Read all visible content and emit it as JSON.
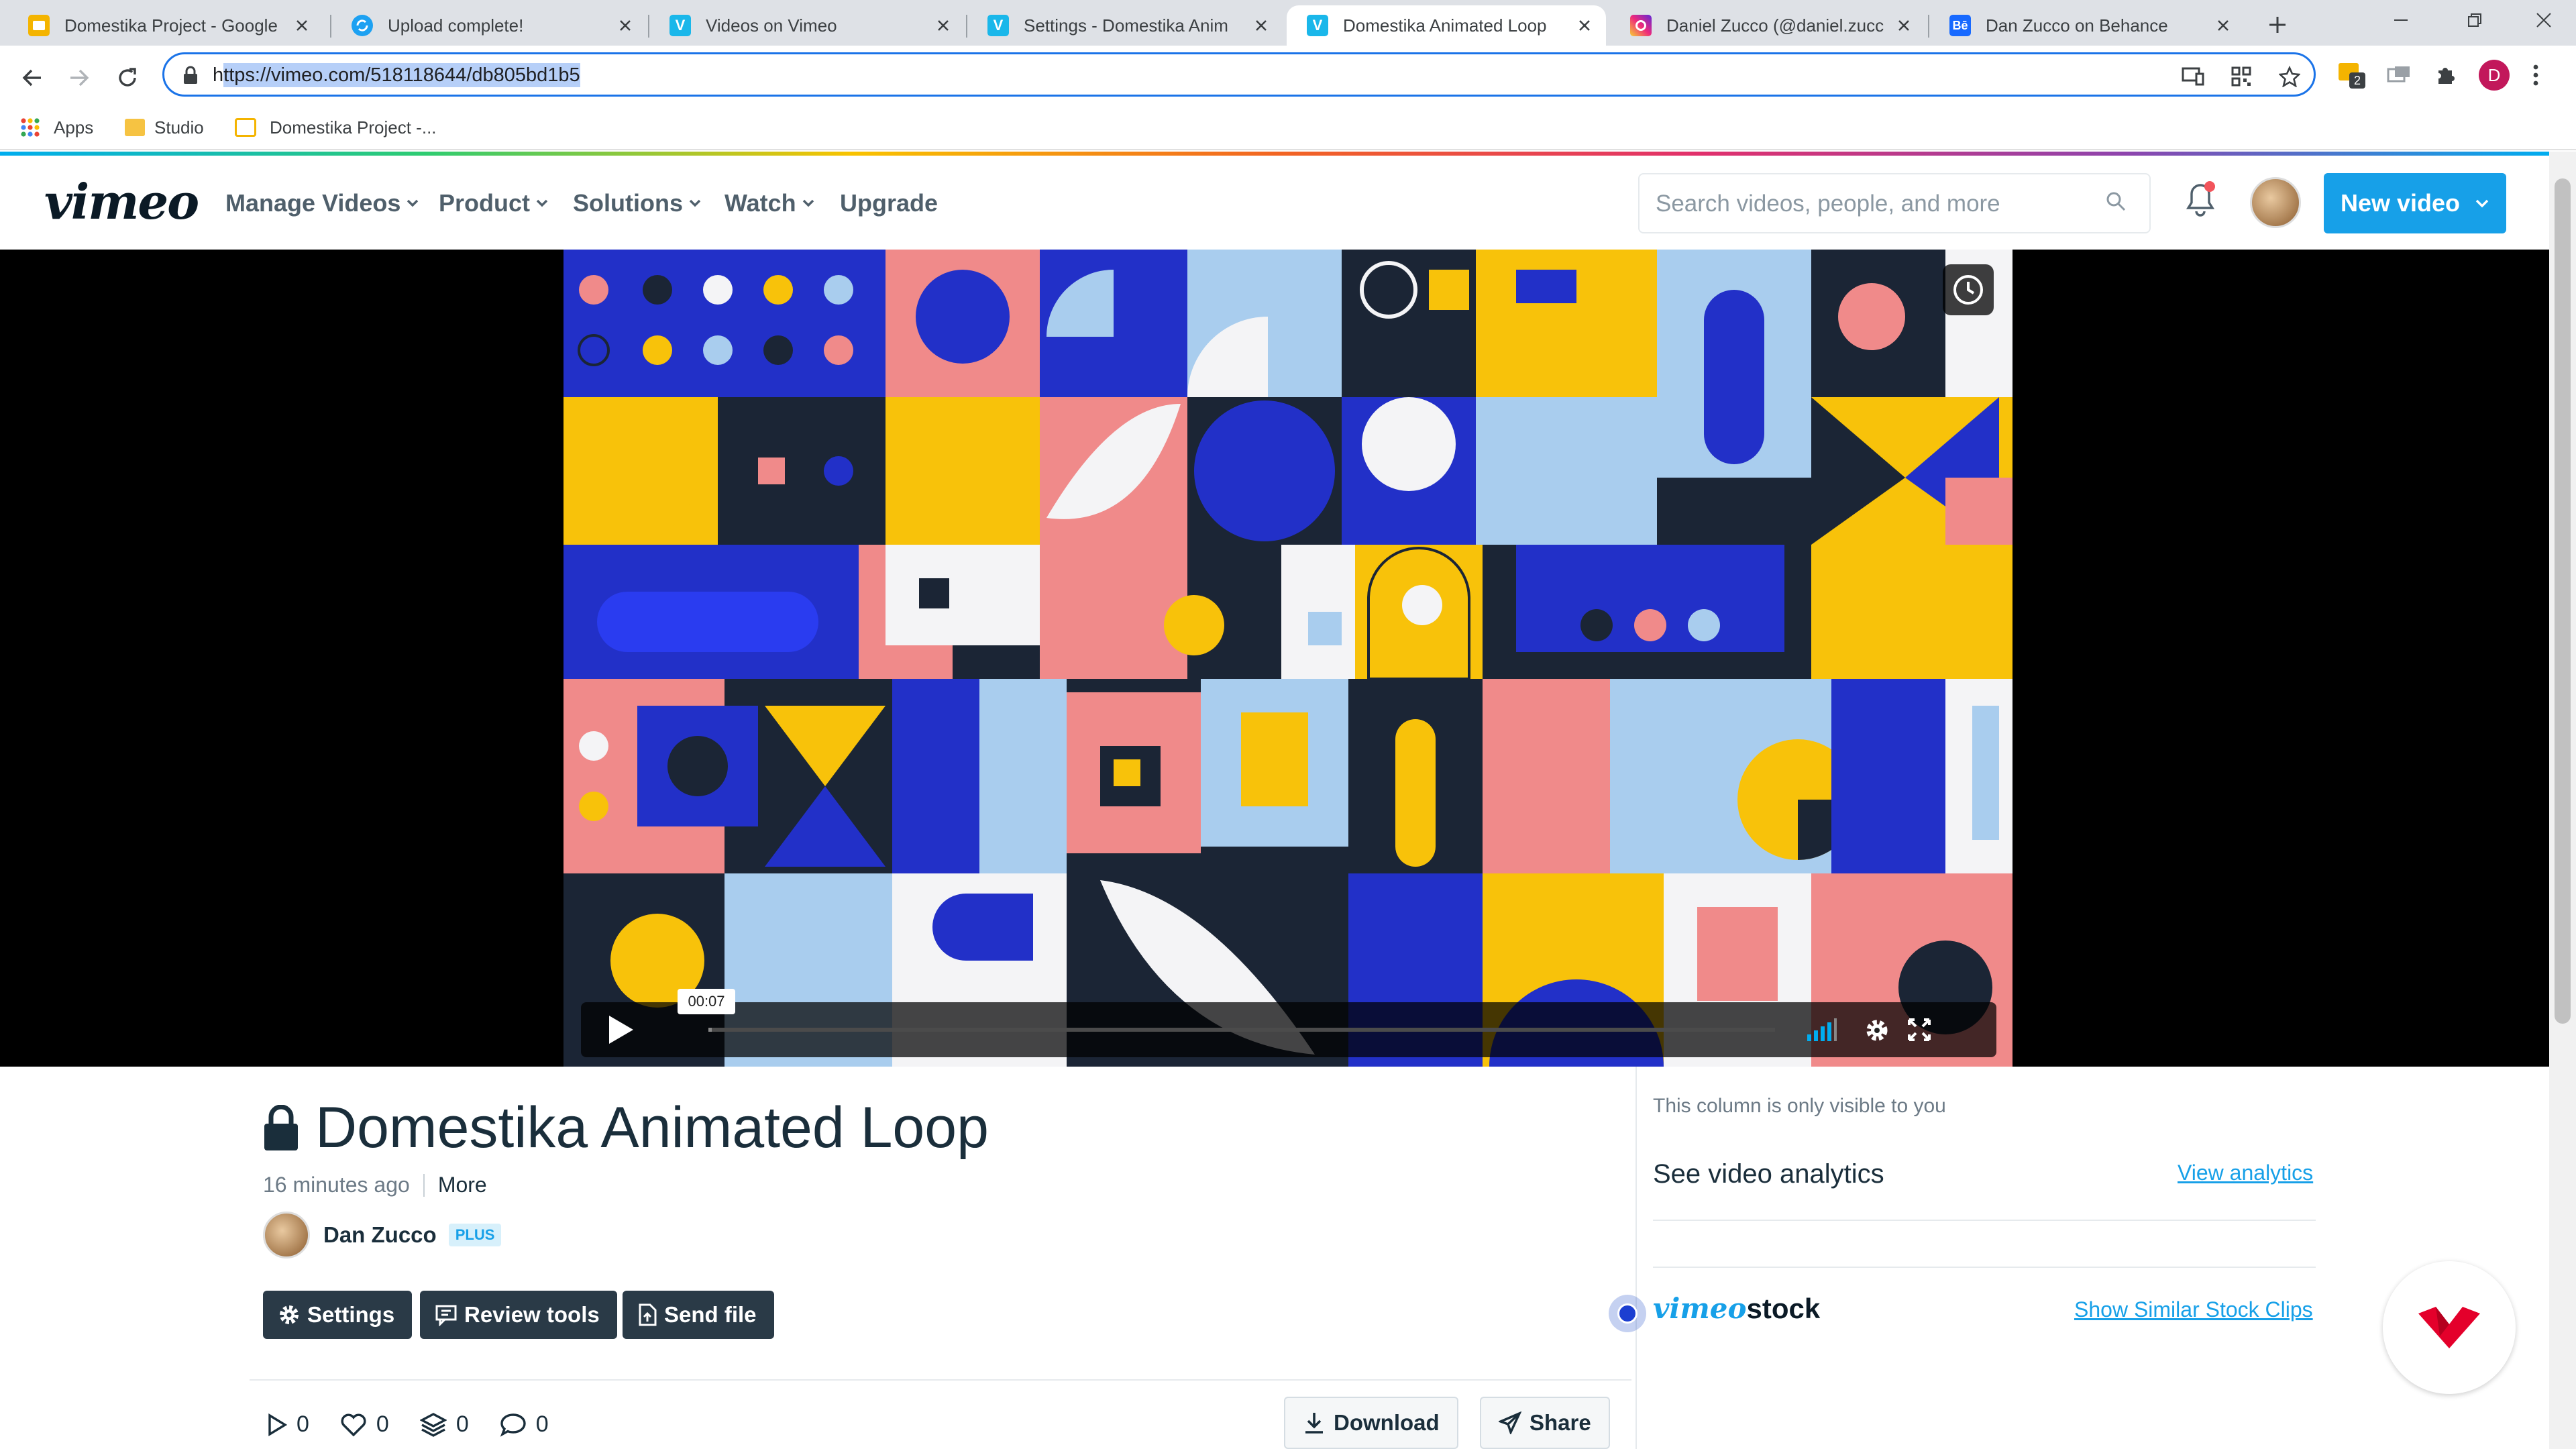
{
  "browser": {
    "tabs": [
      {
        "title": "Domestika Project - Google",
        "icon": "google-slides-icon",
        "color": "#f4b400"
      },
      {
        "title": "Upload complete!",
        "icon": "sync-icon",
        "color": "#1da1f2"
      },
      {
        "title": "Videos on Vimeo",
        "icon": "vimeo-icon",
        "color": "#1ab7ea"
      },
      {
        "title": "Settings - Domestika Anim",
        "icon": "vimeo-icon",
        "color": "#1ab7ea"
      },
      {
        "title": "Domestika Animated Loop",
        "icon": "vimeo-icon",
        "color": "#1ab7ea",
        "active": true
      },
      {
        "title": "Daniel Zucco (@daniel.zucc",
        "icon": "instagram-icon",
        "color": "#e1306c"
      },
      {
        "title": "Dan Zucco on Behance",
        "icon": "behance-icon",
        "color": "#1769ff"
      }
    ],
    "url_prefix": "h",
    "url_selected": "ttps://vimeo.com/518118644/db805bd1b5",
    "extension_badge": "2",
    "profile_initial": "D",
    "bookmarks": {
      "apps": "Apps",
      "studio": "Studio",
      "domestika": "Domestika Project -..."
    }
  },
  "vimeo": {
    "logo": "vimeo",
    "nav": [
      "Manage Videos",
      "Product",
      "Solutions",
      "Watch",
      "Upgrade"
    ],
    "search_placeholder": "Search videos, people, and more",
    "new_video": "New video",
    "player": {
      "time": "00:07",
      "progress": 0.003
    },
    "video": {
      "title": "Domestika Animated Loop",
      "uploaded": "16 minutes ago",
      "more": "More",
      "owner": "Dan Zucco",
      "owner_badge": "PLUS",
      "actions": [
        "Settings",
        "Review tools",
        "Send file"
      ],
      "stats": {
        "plays": "0",
        "likes": "0",
        "collections": "0",
        "comments": "0"
      },
      "download": "Download",
      "share": "Share"
    },
    "sidebar": {
      "note": "This column is only visible to you",
      "analytics_heading": "See video analytics",
      "analytics_link": "View analytics",
      "stock_brand_v": "vimeo",
      "stock_brand_s": "stock",
      "stock_link": "Show Similar Stock Clips"
    }
  },
  "colors": {
    "accent": "#17a0e8",
    "yellow": "#f8c20a",
    "blue": "#2230c8",
    "pink": "#f08a8a",
    "light_blue": "#a9cdee",
    "white": "#f4f4f6",
    "navy": "#1b2535"
  }
}
